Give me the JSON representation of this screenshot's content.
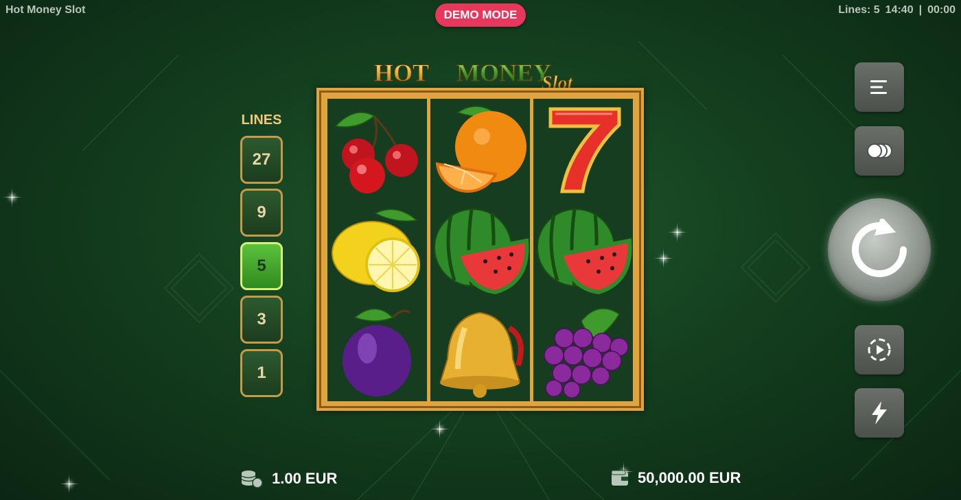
{
  "header": {
    "game_title": "Hot Money Slot",
    "demo_badge": "DEMO MODE",
    "status_lines": "Lines: 5",
    "clock": "14:40",
    "session_timer": "00:00"
  },
  "logo": {
    "word_hot": "HOT",
    "word_money": "MONEY",
    "word_slot": "Slot",
    "coin_symbol": "$"
  },
  "lines_panel": {
    "label": "LINES",
    "options": [
      "27",
      "9",
      "5",
      "3",
      "1"
    ],
    "selected": "5"
  },
  "reels": [
    [
      "cherries",
      "lemon",
      "plum"
    ],
    [
      "orange",
      "watermelon",
      "bell"
    ],
    [
      "seven",
      "watermelon",
      "grapes"
    ]
  ],
  "side_controls": {
    "menu": "menu-icon",
    "bet_coins": "coins-icon",
    "spin": "spin-icon",
    "autoplay": "autoplay-icon",
    "turbo": "turbo-icon"
  },
  "footer": {
    "bet": "1.00 EUR",
    "balance": "50,000.00 EUR"
  },
  "colors": {
    "background": "#1b4d26",
    "demo_badge": "#e8375c",
    "reel_frame": "#e0a540",
    "active_line": "#5cc23c"
  }
}
